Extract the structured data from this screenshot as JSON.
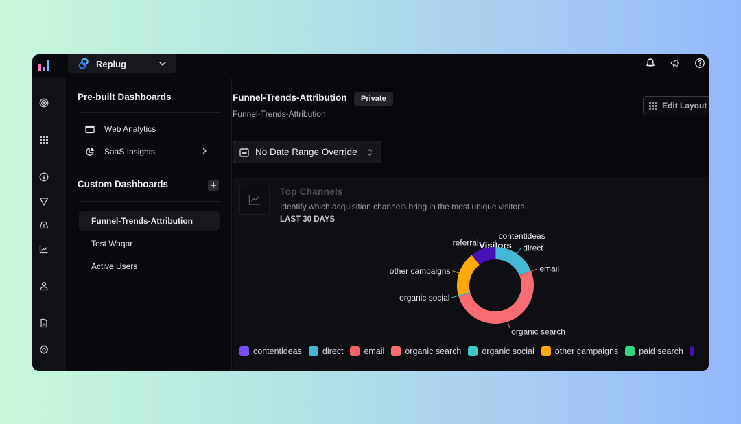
{
  "topbar": {
    "workspace_name": "Replug",
    "logo_colors": [
      "#f47bb5",
      "#b88cf0",
      "#5ec6f2"
    ]
  },
  "rail": {
    "items": [
      {
        "icon": "target-icon"
      },
      {
        "icon": "grid-icon"
      },
      {
        "icon": "dollar-icon"
      },
      {
        "icon": "funnel-icon"
      },
      {
        "icon": "alert-icon"
      },
      {
        "icon": "line-chart-icon"
      },
      {
        "icon": "user-icon"
      },
      {
        "icon": "report-icon"
      },
      {
        "icon": "settings-icon"
      }
    ]
  },
  "sidebar": {
    "prebuilt_title": "Pre-built Dashboards",
    "prebuilt_items": [
      {
        "label": "Web Analytics",
        "icon": "browser-window-icon"
      },
      {
        "label": "SaaS Insights",
        "icon": "pie-chart-icon",
        "has_submenu": true
      }
    ],
    "custom_title": "Custom Dashboards",
    "custom_items": [
      {
        "label": "Funnel-Trends-Attribution",
        "active": true
      },
      {
        "label": "Test Waqar",
        "active": false
      },
      {
        "label": "Active Users",
        "active": false
      }
    ]
  },
  "main": {
    "title": "Funnel-Trends-Attribution",
    "badge": "Private",
    "subtitle": "Funnel-Trends-Attribution",
    "edit_layout_label": "Edit Layout",
    "date_range_label": "No Date Range Override"
  },
  "card": {
    "title": "Top Channels",
    "description": "Identify which acquisition channels bring in the most unique visitors.",
    "range": "LAST 30 DAYS"
  },
  "chart_data": {
    "type": "pie",
    "variant": "donut",
    "title": "Visitors",
    "categories": [
      "contentideas",
      "direct",
      "email",
      "organic search",
      "organic social",
      "other campaigns",
      "paid search",
      "referral"
    ],
    "values": [
      0.3,
      18.5,
      0.4,
      51.2,
      0.5,
      18.6,
      0,
      10.5
    ],
    "colors": [
      "#7c4dff",
      "#44b7d4",
      "#f0626a",
      "#f86c72",
      "#3ec9c2",
      "#ffaa0a",
      "#2fd67f",
      "#4a10b8"
    ],
    "unit": "percent of visitors (estimated)",
    "legend_position": "bottom",
    "legend_entries_visible": [
      "contentideas",
      "direct",
      "email",
      "organic search",
      "organic social",
      "other campaigns",
      "paid search"
    ]
  }
}
